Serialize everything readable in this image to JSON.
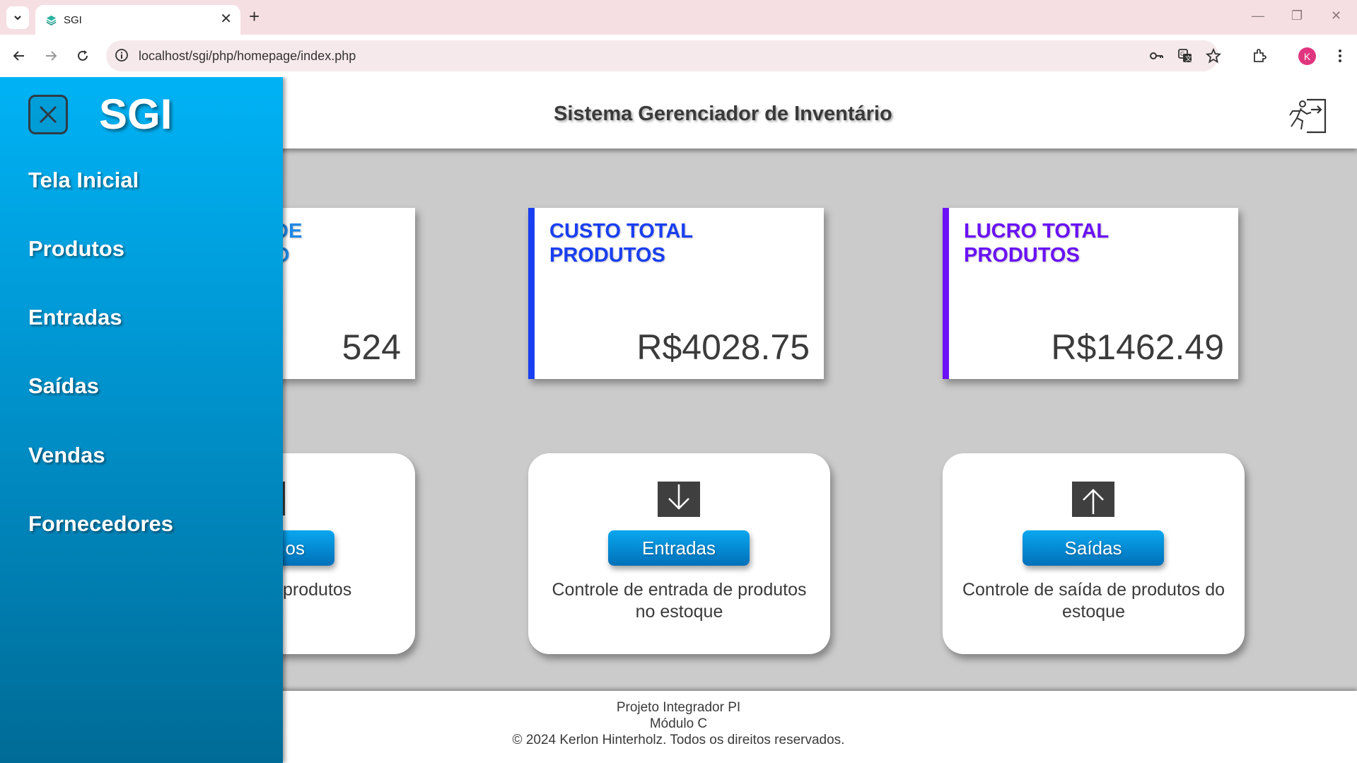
{
  "browser": {
    "tab_title": "SGI",
    "url": "localhost/sgi/php/homepage/index.php",
    "profile_initial": "K",
    "profile_color": "#e0357f"
  },
  "header": {
    "title": "Sistema Gerenciador de Inventário"
  },
  "sidebar": {
    "brand": "SGI",
    "items": [
      {
        "label": "Tela Inicial"
      },
      {
        "label": "Produtos"
      },
      {
        "label": "Entradas"
      },
      {
        "label": "Saídas"
      },
      {
        "label": "Vendas"
      },
      {
        "label": "Fornecedores"
      }
    ]
  },
  "stats": [
    {
      "title_visible": "DE\nO",
      "value": "524",
      "color": "#1e88e5"
    },
    {
      "title": "CUSTO TOTAL PRODUTOS",
      "value": "R$4028.75",
      "color": "#1a3ff0"
    },
    {
      "title": "LUCRO TOTAL PRODUTOS",
      "value": "R$1462.49",
      "color": "#6a12f5"
    }
  ],
  "actions": [
    {
      "button_visible": "os",
      "description_visible": "produtos"
    },
    {
      "button": "Entradas",
      "description": "Controle de entrada de produtos no estoque",
      "icon": "arrow-down-icon"
    },
    {
      "button": "Saídas",
      "description": "Controle de saída de produtos do estoque",
      "icon": "arrow-up-icon"
    }
  ],
  "footer": {
    "line1": "Projeto Integrador PI",
    "line2": "Módulo C",
    "line3": "© 2024 Kerlon Hinterholz. Todos os direitos reservados."
  }
}
